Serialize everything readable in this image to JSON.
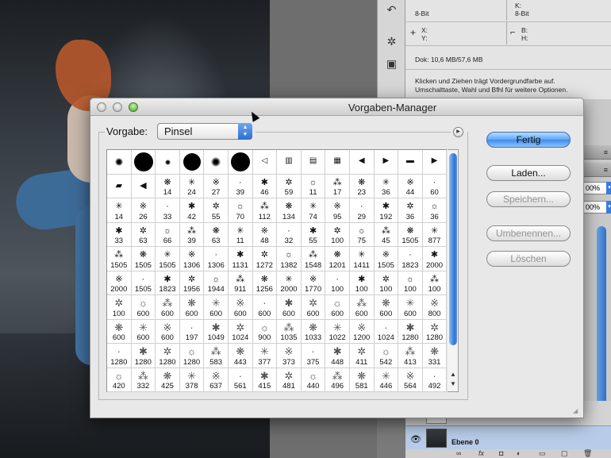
{
  "info_panel": {
    "bits_left": "8-Bit",
    "bits_right": "8-Bit",
    "k_label": "K:",
    "x_label": "X:",
    "y_label": "Y:",
    "b_label": "B:",
    "h_label": "H:",
    "doc": "Dok: 10,6 MB/57,6 MB",
    "hint_line1": "Klicken und Ziehen trägt Vordergrundfarbe auf.",
    "hint_line2": "Umschalttaste, Wahl und Bfhl für weitere Optionen."
  },
  "right_panels": {
    "pct1": "00%",
    "pct2": "00%"
  },
  "layers": {
    "layer_name": "Ebene 0"
  },
  "dialog": {
    "title": "Vorgaben-Manager",
    "preset_label": "Vorgabe:",
    "preset_value": "Pinsel",
    "buttons": {
      "done": "Fertig",
      "load": "Laden...",
      "save": "Speichern...",
      "rename": "Umbenennen...",
      "delete": "Löschen"
    }
  },
  "brush_rows": [
    [
      "",
      "",
      "",
      "",
      "",
      "",
      "",
      "",
      "",
      "",
      "",
      "",
      "",
      ""
    ],
    [
      "",
      "",
      "14",
      "24",
      "27",
      "39",
      "46",
      "59",
      "11",
      "17",
      "23",
      "36",
      "44",
      "60"
    ],
    [
      "14",
      "26",
      "33",
      "42",
      "55",
      "70",
      "112",
      "134",
      "74",
      "95",
      "29",
      "192",
      "36",
      "36"
    ],
    [
      "33",
      "63",
      "66",
      "39",
      "63",
      "11",
      "48",
      "32",
      "55",
      "100",
      "75",
      "45",
      "1505",
      "877"
    ],
    [
      "1505",
      "1505",
      "1505",
      "1306",
      "1306",
      "1131",
      "1272",
      "1382",
      "1548",
      "1201",
      "1411",
      "1505",
      "1823",
      "2000"
    ],
    [
      "2000",
      "1505",
      "1823",
      "1956",
      "1944",
      "911",
      "1256",
      "2000",
      "1770",
      "100",
      "100",
      "100",
      "100",
      "100"
    ],
    [
      "100",
      "600",
      "600",
      "600",
      "600",
      "600",
      "600",
      "600",
      "600",
      "600",
      "600",
      "600",
      "600",
      "800"
    ],
    [
      "600",
      "600",
      "600",
      "197",
      "1049",
      "1024",
      "900",
      "1035",
      "1033",
      "1022",
      "1200",
      "1024",
      "1280",
      "1280"
    ],
    [
      "1280",
      "1280",
      "1280",
      "1280",
      "583",
      "443",
      "377",
      "373",
      "375",
      "448",
      "411",
      "542",
      "413",
      "331"
    ],
    [
      "420",
      "332",
      "425",
      "378",
      "637",
      "561",
      "415",
      "481",
      "440",
      "496",
      "581",
      "446",
      "564",
      "492"
    ]
  ]
}
